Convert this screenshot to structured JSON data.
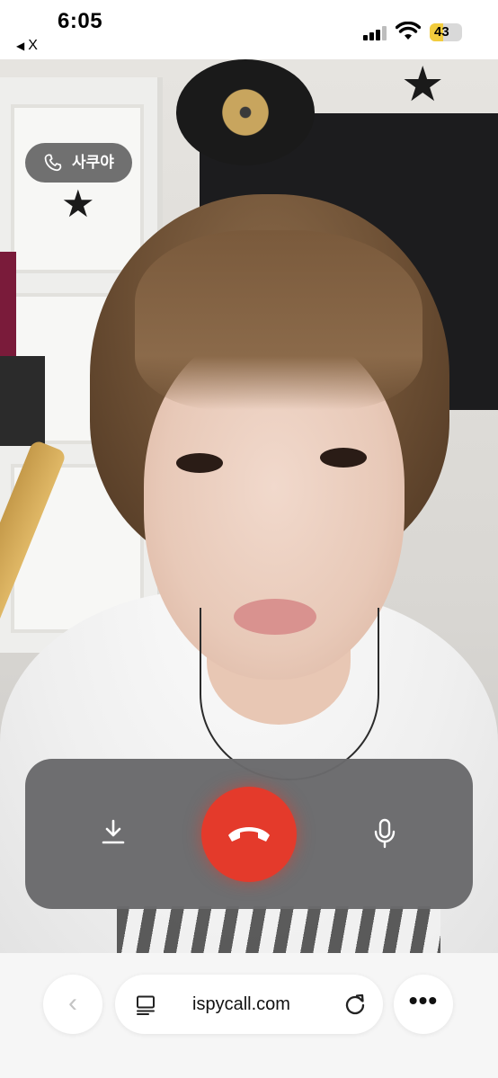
{
  "status_bar": {
    "time": "6:05",
    "back_app_label": "X",
    "back_arrow_glyph": "◀",
    "battery_level": "43",
    "battery_fraction": 0.43,
    "battery_color": "#f2cc3d"
  },
  "call": {
    "caller_name": "사쿠야",
    "end_call_color": "#e43a2b",
    "icons": {
      "caller": "phone-icon",
      "download": "download-icon",
      "end_call": "end-call-icon",
      "mic": "microphone-icon"
    }
  },
  "browser": {
    "url": "ispycall.com",
    "back_glyph": "‹",
    "more_glyph": "•••",
    "icons": {
      "back": "chevron-left-icon",
      "reader": "reader-mode-icon",
      "reload": "reload-icon",
      "more": "more-icon"
    }
  }
}
